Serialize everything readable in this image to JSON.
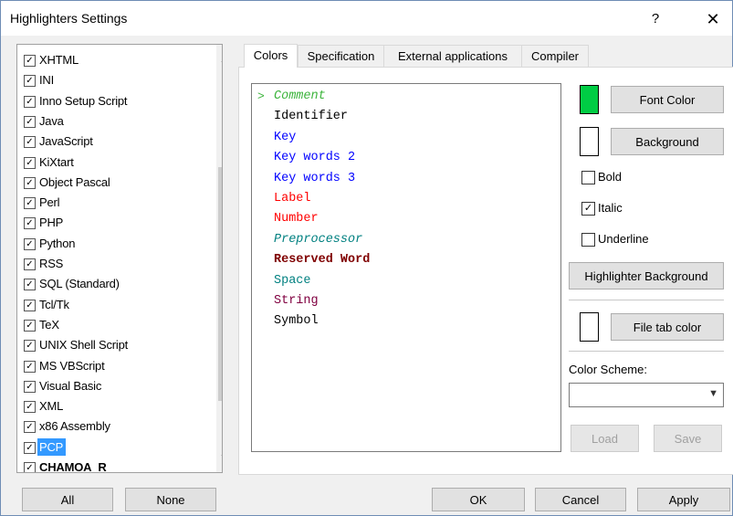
{
  "window": {
    "title": "Highlighters Settings",
    "help": "?",
    "close": "✕"
  },
  "languages": [
    {
      "label": "XHTML",
      "checked": true
    },
    {
      "label": "INI",
      "checked": true
    },
    {
      "label": "Inno Setup Script",
      "checked": true
    },
    {
      "label": "Java",
      "checked": true
    },
    {
      "label": "JavaScript",
      "checked": true
    },
    {
      "label": "KiXtart",
      "checked": true
    },
    {
      "label": "Object Pascal",
      "checked": true
    },
    {
      "label": "Perl",
      "checked": true
    },
    {
      "label": "PHP",
      "checked": true
    },
    {
      "label": "Python",
      "checked": true
    },
    {
      "label": "RSS",
      "checked": true
    },
    {
      "label": "SQL (Standard)",
      "checked": true
    },
    {
      "label": "Tcl/Tk",
      "checked": true
    },
    {
      "label": "TeX",
      "checked": true
    },
    {
      "label": "UNIX Shell Script",
      "checked": true
    },
    {
      "label": "MS VBScript",
      "checked": true
    },
    {
      "label": "Visual Basic",
      "checked": true
    },
    {
      "label": "XML",
      "checked": true
    },
    {
      "label": "x86 Assembly",
      "checked": true
    },
    {
      "label": "PCP",
      "checked": true,
      "selected": true
    },
    {
      "label": "CHAMOA_R",
      "checked": true
    }
  ],
  "tabs": [
    "Colors",
    "Specification",
    "External applications",
    "Compiler"
  ],
  "elements": [
    {
      "label": "Comment",
      "color": "#3cb43c",
      "italic": true,
      "current": true
    },
    {
      "label": "Identifier",
      "color": "#000000"
    },
    {
      "label": "Key",
      "color": "#0000ff"
    },
    {
      "label": "Key words 2",
      "color": "#0000ff"
    },
    {
      "label": "Key words 3",
      "color": "#0000ff"
    },
    {
      "label": "Label",
      "color": "#ff0000"
    },
    {
      "label": "Number",
      "color": "#ff0000"
    },
    {
      "label": "Preprocessor",
      "color": "#008080",
      "italic": true
    },
    {
      "label": "Reserved Word",
      "color": "#800000",
      "bold": true
    },
    {
      "label": "Space",
      "color": "#008080"
    },
    {
      "label": "String",
      "color": "#800040"
    },
    {
      "label": "Symbol",
      "color": "#000000"
    }
  ],
  "element_marker": ">",
  "colors": {
    "font_color_swatch": "#00cc44",
    "background_swatch": "#ffffff",
    "file_tab_swatch": "#ffffff"
  },
  "buttons": {
    "font_color": "Font Color",
    "background": "Background",
    "highlighter_background": "Highlighter Background",
    "file_tab_color": "File tab color",
    "load": "Load",
    "save": "Save",
    "all": "All",
    "none": "None",
    "ok": "OK",
    "cancel": "Cancel",
    "apply": "Apply"
  },
  "style_checks": [
    {
      "label": "Bold",
      "checked": false
    },
    {
      "label": "Italic",
      "checked": true
    },
    {
      "label": "Underline",
      "checked": false
    }
  ],
  "scheme": {
    "label": "Color Scheme:",
    "value": ""
  },
  "check_glyph": "✓",
  "scroll": {
    "up": "▲",
    "down": "▼"
  },
  "dropdown_glyph": "▼"
}
